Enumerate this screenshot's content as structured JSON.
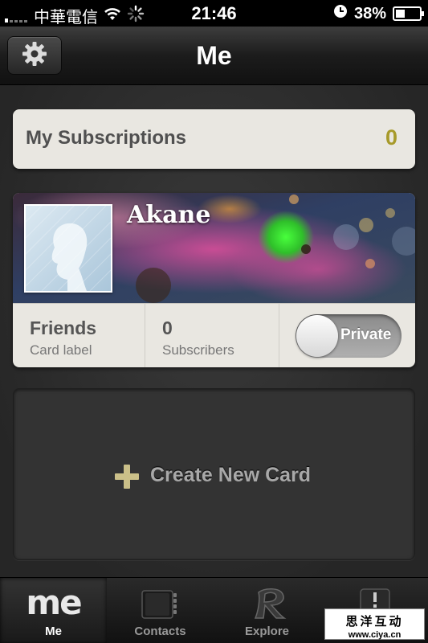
{
  "status_bar": {
    "carrier": "中華電信",
    "time": "21:46",
    "battery_percent_label": "38%",
    "battery_level": 0.38,
    "icons": [
      "signal-icon",
      "wifi-icon",
      "activity-spinner-icon",
      "clock-icon",
      "battery-icon"
    ]
  },
  "nav": {
    "title": "Me",
    "settings_icon": "gear-icon"
  },
  "subscriptions": {
    "label": "My Subscriptions",
    "count": "0"
  },
  "profile": {
    "name": "Akane",
    "avatar_icon": "avatar-silhouette-icon",
    "group_value": "Friends",
    "group_label": "Card label",
    "subscribers_value": "0",
    "subscribers_label": "Subscribers",
    "privacy_label": "Private",
    "privacy_on": false
  },
  "create_card": {
    "label": "Create New Card",
    "icon": "plus-icon"
  },
  "tabs": [
    {
      "label": "Me",
      "icon_text": "me",
      "icon": "me-icon",
      "active": true
    },
    {
      "label": "Contacts",
      "icon": "contacts-book-icon",
      "active": false
    },
    {
      "label": "Explore",
      "icon": "explore-r-icon",
      "active": false
    },
    {
      "label": "",
      "icon": "alert-icon",
      "active": false
    }
  ],
  "watermark": {
    "line1": "思洋互动",
    "line2": "www.ciya.cn"
  },
  "colors": {
    "accent_gold": "#a79a2a",
    "plus_gold": "#cbc089",
    "card_bg": "#e9e7e1"
  }
}
